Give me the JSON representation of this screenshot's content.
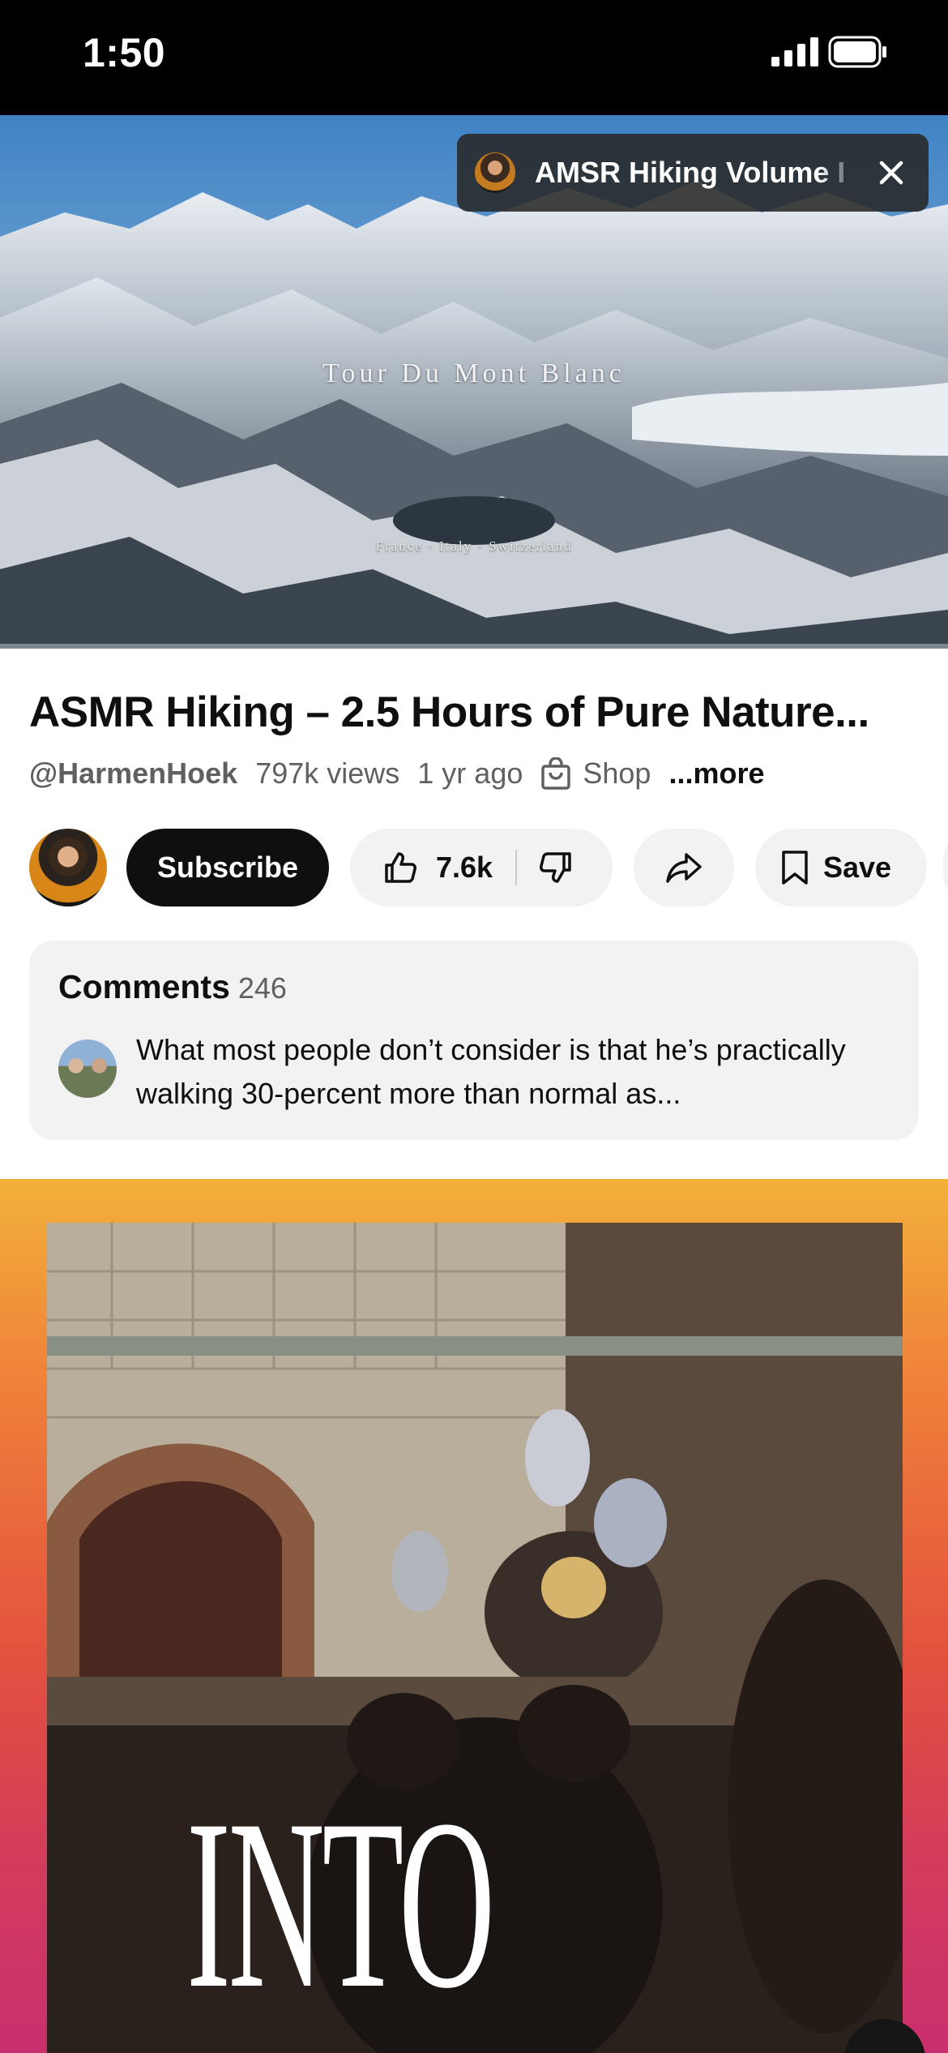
{
  "status_bar": {
    "time": "1:50"
  },
  "player": {
    "overlay_title": "Tour Du Mont Blanc",
    "overlay_subtitle": "France · Italy · Switzerland"
  },
  "mini_banner": {
    "title": "AMSR Hiking Volume I"
  },
  "video": {
    "title": "ASMR Hiking – 2.5 Hours of Pure Nature...",
    "channel_handle": "@HarmenHoek",
    "views": "797k views",
    "age": "1 yr ago",
    "shop_label": "Shop",
    "more_label": "...more"
  },
  "actions": {
    "subscribe_label": "Subscribe",
    "like_count": "7.6k",
    "save_label": "Save"
  },
  "comments": {
    "header": "Comments",
    "count": "246",
    "top_comment": "What most people don’t consider is that he’s practically walking 30-percent more than normal as..."
  },
  "next_short": {
    "caption": "INTO"
  },
  "icons": {
    "signal": "signal-bars-icon",
    "battery": "battery-icon",
    "close": "close-icon",
    "shop": "shopping-bag-icon",
    "like": "thumbs-up-icon",
    "dislike": "thumbs-down-icon",
    "share": "share-arrow-icon",
    "save": "bookmark-icon"
  },
  "colors": {
    "subscribe_bg": "#0f0f0f",
    "pill_bg": "#f2f2f2",
    "meta_text": "#606060"
  }
}
